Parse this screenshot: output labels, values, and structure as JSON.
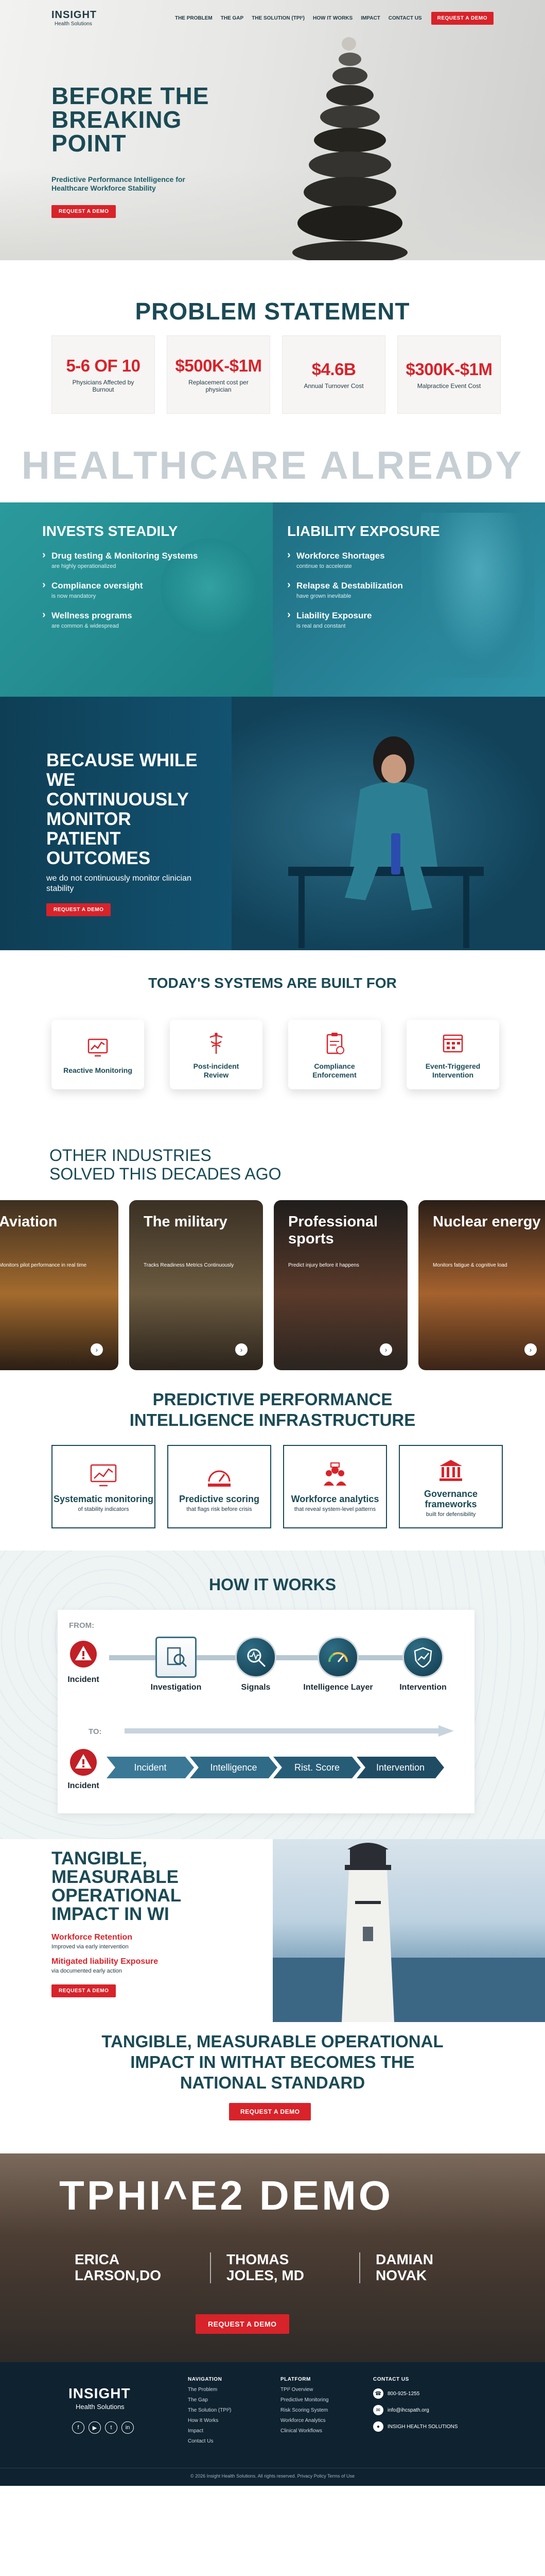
{
  "nav": {
    "logo_main": "INSIGHT",
    "logo_sub": "Health Solutions",
    "items": [
      "THE PROBLEM",
      "THE GAP",
      "THE SOLUTION (TPI²)",
      "HOW IT WORKS",
      "IMPACT",
      "CONTACT US"
    ],
    "cta": "REQUEST A DEMO"
  },
  "hero": {
    "title_line1": "BEFORE THE",
    "title_line2": "BREAKING",
    "title_line3": "POINT",
    "subtitle": "Predictive Performance Intelligence for Healthcare Workforce Stability",
    "cta": "REQUEST A DEMO"
  },
  "problem": {
    "title": "PROBLEM STATEMENT",
    "stats": [
      {
        "num": "5-6 OF 10",
        "label": "Physicians Affected by Burnout"
      },
      {
        "num": "$500K-$1M",
        "label": "Replacement cost per physician"
      },
      {
        "num": "$4.6B",
        "label": "Annual Turnover Cost"
      },
      {
        "num": "$300K-$1M",
        "label": "Malpractice Event Cost"
      }
    ],
    "big_word": "HEALTHCARE ALREADY"
  },
  "invests": {
    "title": "INVESTS STEADILY",
    "items": [
      {
        "title": "Drug testing & Monitoring Systems",
        "sub": "are highly operationalized"
      },
      {
        "title": "Compliance oversight",
        "sub": "is now mandatory"
      },
      {
        "title": "Wellness programs",
        "sub": "are common & widespread"
      }
    ]
  },
  "liability": {
    "title": "LIABILITY EXPOSURE",
    "items": [
      {
        "title": "Workforce Shortages",
        "sub": "continue to accelerate"
      },
      {
        "title": "Relapse & Destabilization",
        "sub": "have grown inevitable"
      },
      {
        "title": "Liability Exposure",
        "sub": "is real and constant"
      }
    ]
  },
  "nurse": {
    "title": "BECAUSE WHILE WE CONTINUOUSLY MONITOR PATIENT OUTCOMES",
    "text": "we do not continuously monitor clinician stability",
    "cta": "REQUEST A DEMO"
  },
  "systems": {
    "title": "TODAY'S SYSTEMS ARE BUILT FOR",
    "items": [
      "Reactive Monitoring",
      "Post-incident Review",
      "Compliance Enforcement",
      "Event-Triggered Intervention"
    ]
  },
  "industries": {
    "title_line1": "OTHER INDUSTRIES",
    "title_line2": "SOLVED THIS DECADES AGO",
    "cards": [
      {
        "title": "Aviation",
        "sub": "Monitors pilot performance in real time"
      },
      {
        "title": "The military",
        "sub": "Tracks Readiness Metrics Continuously"
      },
      {
        "title": "Professional sports",
        "sub": "Predict injury before it happens"
      },
      {
        "title": "Nuclear energy",
        "sub": "Monitors fatigue & cognitive load"
      }
    ]
  },
  "infra": {
    "title_line1": "PREDICTIVE PERFORMANCE",
    "title_line2": "INTELLIGENCE INFRASTRUCTURE",
    "items": [
      {
        "title": "Systematic monitoring",
        "sub": "of stability indicators"
      },
      {
        "title": "Predictive scoring",
        "sub": "that flags risk before crisis"
      },
      {
        "title": "Workforce analytics",
        "sub": "that reveal system-level patterns"
      },
      {
        "title": "Governance frameworks",
        "sub": "built for defensibility"
      }
    ]
  },
  "how": {
    "title": "HOW IT WORKS",
    "from": "FROM:",
    "to": "TO:",
    "from_steps": [
      "Incident",
      "Investigation",
      "Signals",
      "Intelligence Layer",
      "Intervention"
    ],
    "to_steps": [
      "Incident",
      "Intelligence",
      "Rist. Score",
      "Intervention"
    ]
  },
  "tangible": {
    "title": "TANGIBLE, MEASURABLE OPERATIONAL IMPACT IN WI",
    "r1": "Workforce Retention",
    "r1s": "Improved via early intervention",
    "r2": "Mitigated liability Exposure",
    "r2s": "via documented early action",
    "cta": "REQUEST A DEMO"
  },
  "national": {
    "title_line1": "TANGIBLE, MEASURABLE OPERATIONAL",
    "title_line2": "IMPACT IN WITHAT BECOMES THE",
    "title_line3": "NATIONAL STANDARD",
    "cta": "REQUEST A DEMO"
  },
  "demo": {
    "title": "TPHI^E2 DEMO",
    "people": [
      {
        "l1": "ERICA",
        "l2": "LARSON,DO"
      },
      {
        "l1": "THOMAS",
        "l2": "JOLES, MD"
      },
      {
        "l1": "DAMIAN",
        "l2": "NOVAK"
      }
    ],
    "cta": "REQUEST A DEMO"
  },
  "footer": {
    "logo_main": "INSIGHT",
    "logo_sub": "Health Solutions",
    "nav_h": "NAVIGATION",
    "nav_items": [
      "The Problem",
      "The Gap",
      "The Solution (TPI²)",
      "How It Works",
      "Impact",
      "Contact Us"
    ],
    "plat_h": "PLATFORM",
    "plat_items": [
      "TPI² Overview",
      "Predictive Monitoring",
      "Risk Scoring System",
      "Workforce Analytics",
      "Clinical Workflows"
    ],
    "contact_h": "CONTACT US",
    "phone": "800-925-1255",
    "email": "info@ihcspath.org",
    "company": "INSIGH HEALTH SOLUTIONS",
    "copyright": "© 2026 Insight Health Solutions. All rights reserved.   Privacy Policy   Terms of Use"
  }
}
